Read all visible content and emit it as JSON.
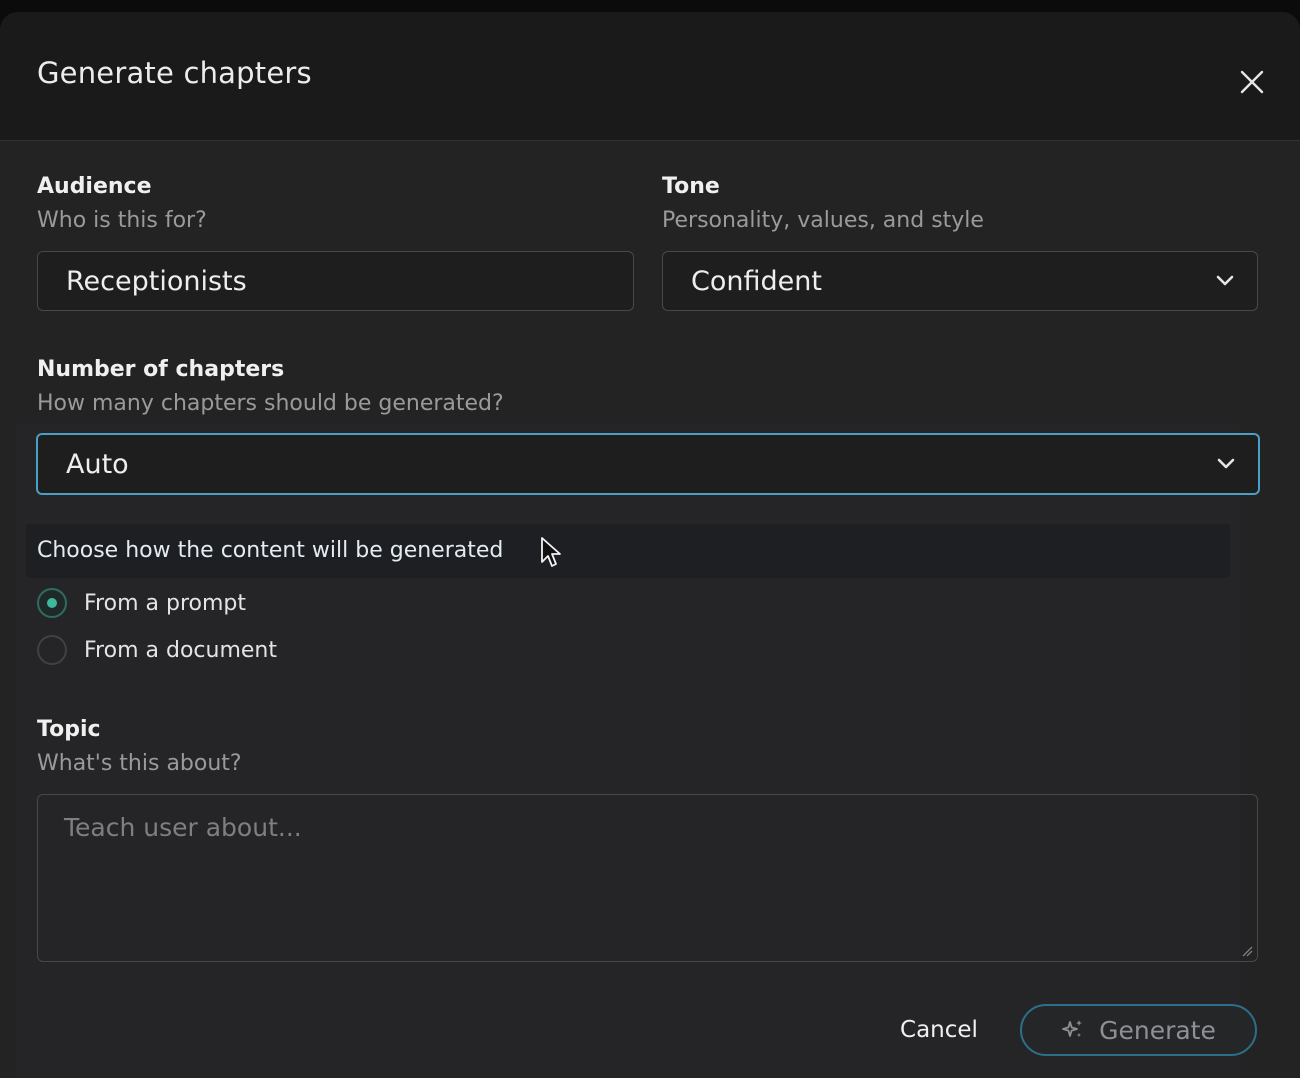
{
  "dialog": {
    "title": "Generate chapters",
    "close_icon": "close-icon"
  },
  "audience": {
    "label": "Audience",
    "sublabel": "Who is this for?",
    "value": "Receptionists"
  },
  "tone": {
    "label": "Tone",
    "sublabel": "Personality, values, and style",
    "value": "Confident"
  },
  "chapters": {
    "label": "Number of chapters",
    "sublabel": "How many chapters should be generated?",
    "value": "Auto"
  },
  "generation_method": {
    "title": "Choose how the content will be generated",
    "options": [
      {
        "label": "From a prompt",
        "checked": true
      },
      {
        "label": "From a document",
        "checked": false
      }
    ]
  },
  "topic": {
    "label": "Topic",
    "sublabel": "What's this about?",
    "placeholder": "Teach user about..."
  },
  "footer": {
    "cancel_label": "Cancel",
    "generate_label": "Generate"
  },
  "colors": {
    "focus_border": "#4a9fc4",
    "radio_accent": "#3fb89d",
    "generate_border": "#2d6f8a"
  }
}
